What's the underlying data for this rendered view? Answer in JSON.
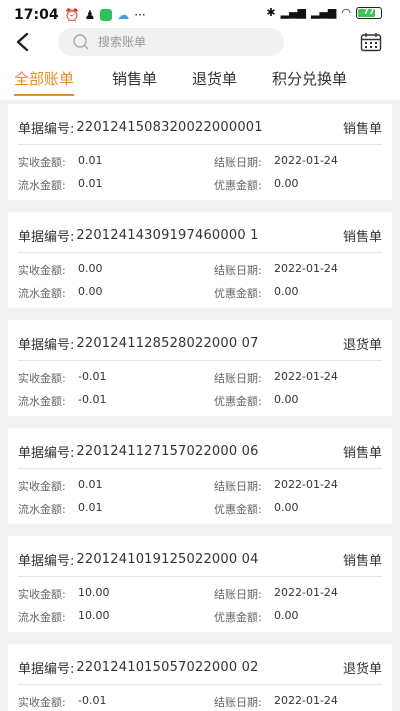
{
  "status": {
    "time": "17:04",
    "battery": "77"
  },
  "search": {
    "placeholder": "搜索账单"
  },
  "tabs": [
    "全部账单",
    "销售单",
    "退货单",
    "积分兑换单"
  ],
  "labels": {
    "no": "单据编号:",
    "received": "实收金额:",
    "flow": "流水金额:",
    "date": "结账日期:",
    "discount": "优惠金额:"
  },
  "orders": [
    {
      "no": "2201241508320022000001",
      "type": "销售单",
      "received": "0.01",
      "flow": "0.01",
      "date": "2022-01-24",
      "discount": "0.00"
    },
    {
      "no": "22012414309197460000 1",
      "type": "销售单",
      "received": "0.00",
      "flow": "0.00",
      "date": "2022-01-24",
      "discount": "0.00"
    },
    {
      "no": "2201241128528022000 07",
      "type": "退货单",
      "received": "-0.01",
      "flow": "-0.01",
      "date": "2022-01-24",
      "discount": "0.00"
    },
    {
      "no": "2201241127157022000 06",
      "type": "销售单",
      "received": "0.01",
      "flow": "0.01",
      "date": "2022-01-24",
      "discount": "0.00"
    },
    {
      "no": "2201241019125022000 04",
      "type": "销售单",
      "received": "10.00",
      "flow": "10.00",
      "date": "2022-01-24",
      "discount": "0.00"
    },
    {
      "no": "2201241015057022000 02",
      "type": "退货单",
      "received": "-0.01",
      "flow": "",
      "date": "2022-01-24",
      "discount": ""
    }
  ]
}
